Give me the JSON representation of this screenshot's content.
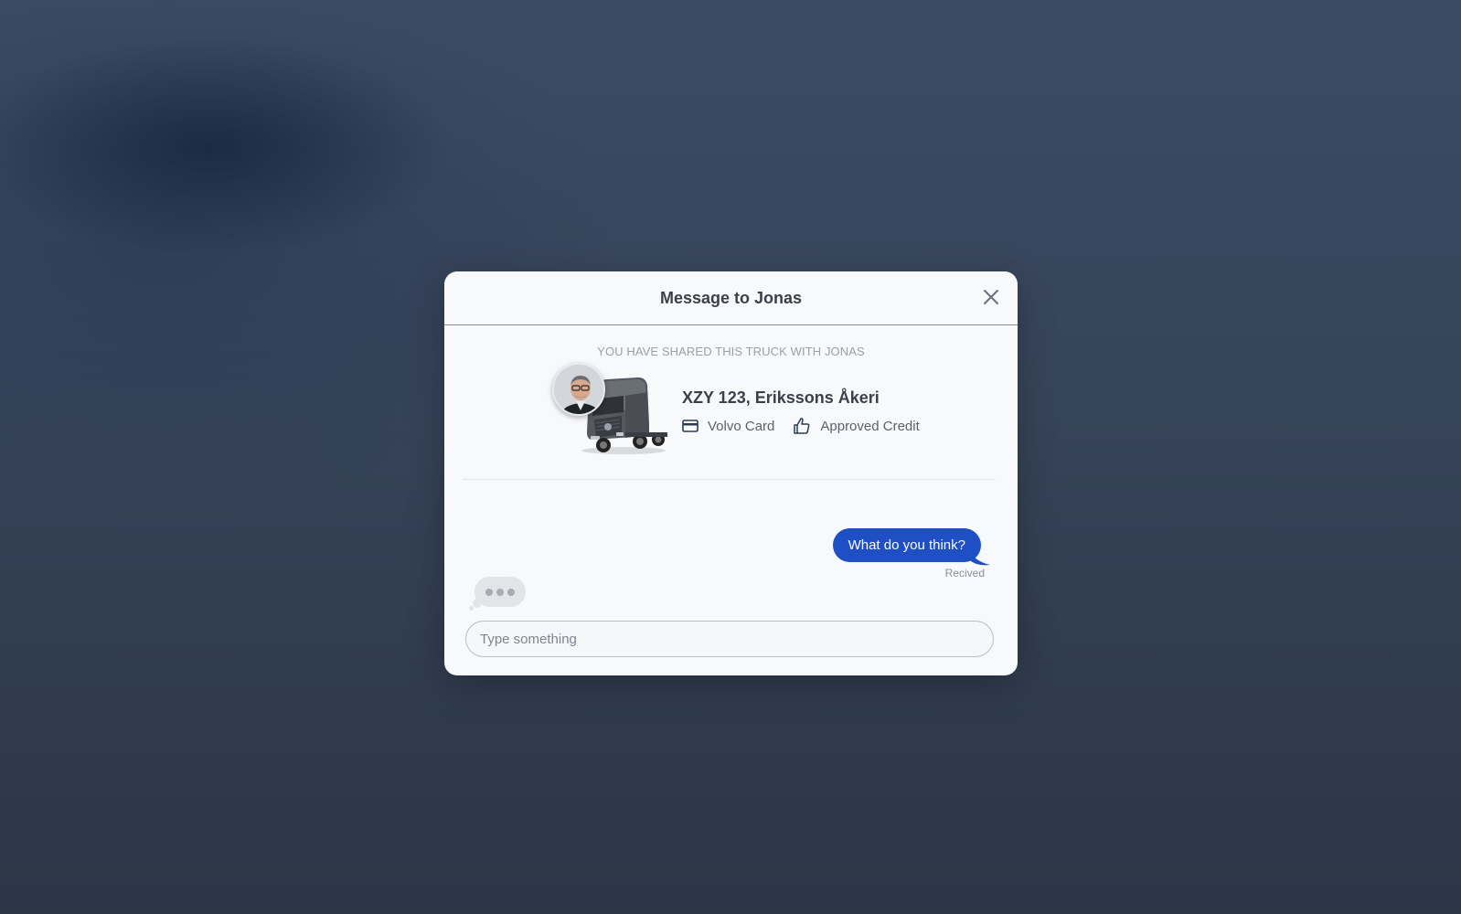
{
  "modal": {
    "title": "Message to Jonas",
    "close_icon": "close-icon"
  },
  "shared": {
    "caption": "YOU HAVE SHARED THIS TRUCK WITH JONAS",
    "truck_name": "XZY 123, Erikssons Åkeri",
    "tags": [
      {
        "icon": "credit-card-icon",
        "label": "Volvo Card"
      },
      {
        "icon": "thumbs-up-icon",
        "label": "Approved Credit"
      }
    ]
  },
  "chat": {
    "messages": [
      {
        "direction": "outgoing",
        "text": "What do you think?",
        "status": "Recived"
      }
    ],
    "typing_indicator": true
  },
  "composer": {
    "placeholder": "Type something",
    "value": ""
  },
  "colors": {
    "accent": "#1e4fc4",
    "modal_bg": "#f8f9fb",
    "backdrop": "#364459"
  }
}
